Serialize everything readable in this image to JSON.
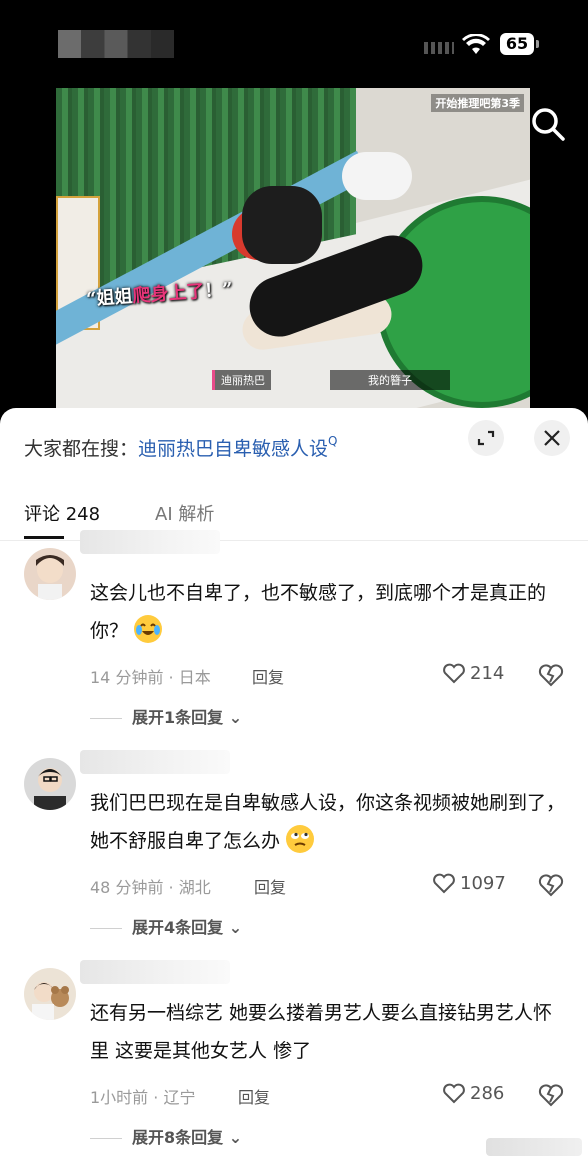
{
  "status_bar": {
    "battery": "65"
  },
  "video": {
    "caption_prefix": "“姐姐",
    "caption_highlight": "爬身上了",
    "caption_suffix": "！”",
    "tag_left": "迪丽热巴",
    "tag_right": "我的簪子",
    "brand": "开始推理吧第3季"
  },
  "search_bar": {
    "prefix": "大家都在搜：",
    "query": "迪丽热巴自卑敏感人设",
    "query_icon": "Q"
  },
  "tabs": [
    {
      "label": "评论 248"
    },
    {
      "label": "AI 解析"
    }
  ],
  "comments": [
    {
      "text": "这会儿也不自卑了，也不敏感了，到底哪个才是真正的你？",
      "emoji": "crying-laughing-face",
      "time_location": "14 分钟前 · 日本",
      "reply_label": "回复",
      "likes": "214",
      "expand": "展开1条回复"
    },
    {
      "text": "我们巴巴现在是自卑敏感人设，你这条视频被她刷到了，她不舒服自卑了怎么办",
      "emoji": "eye-roll-face",
      "time_location": "48 分钟前 · 湖北",
      "reply_label": "回复",
      "likes": "1097",
      "expand": "展开4条回复"
    },
    {
      "text": "还有另一档综艺  她要么搂着男艺人要么直接钻男艺人怀里  这要是其他女艺人  惨了",
      "emoji": "",
      "time_location": "1小时前 · 辽宁",
      "reply_label": "回复",
      "likes": "286",
      "expand": "展开8条回复"
    }
  ]
}
